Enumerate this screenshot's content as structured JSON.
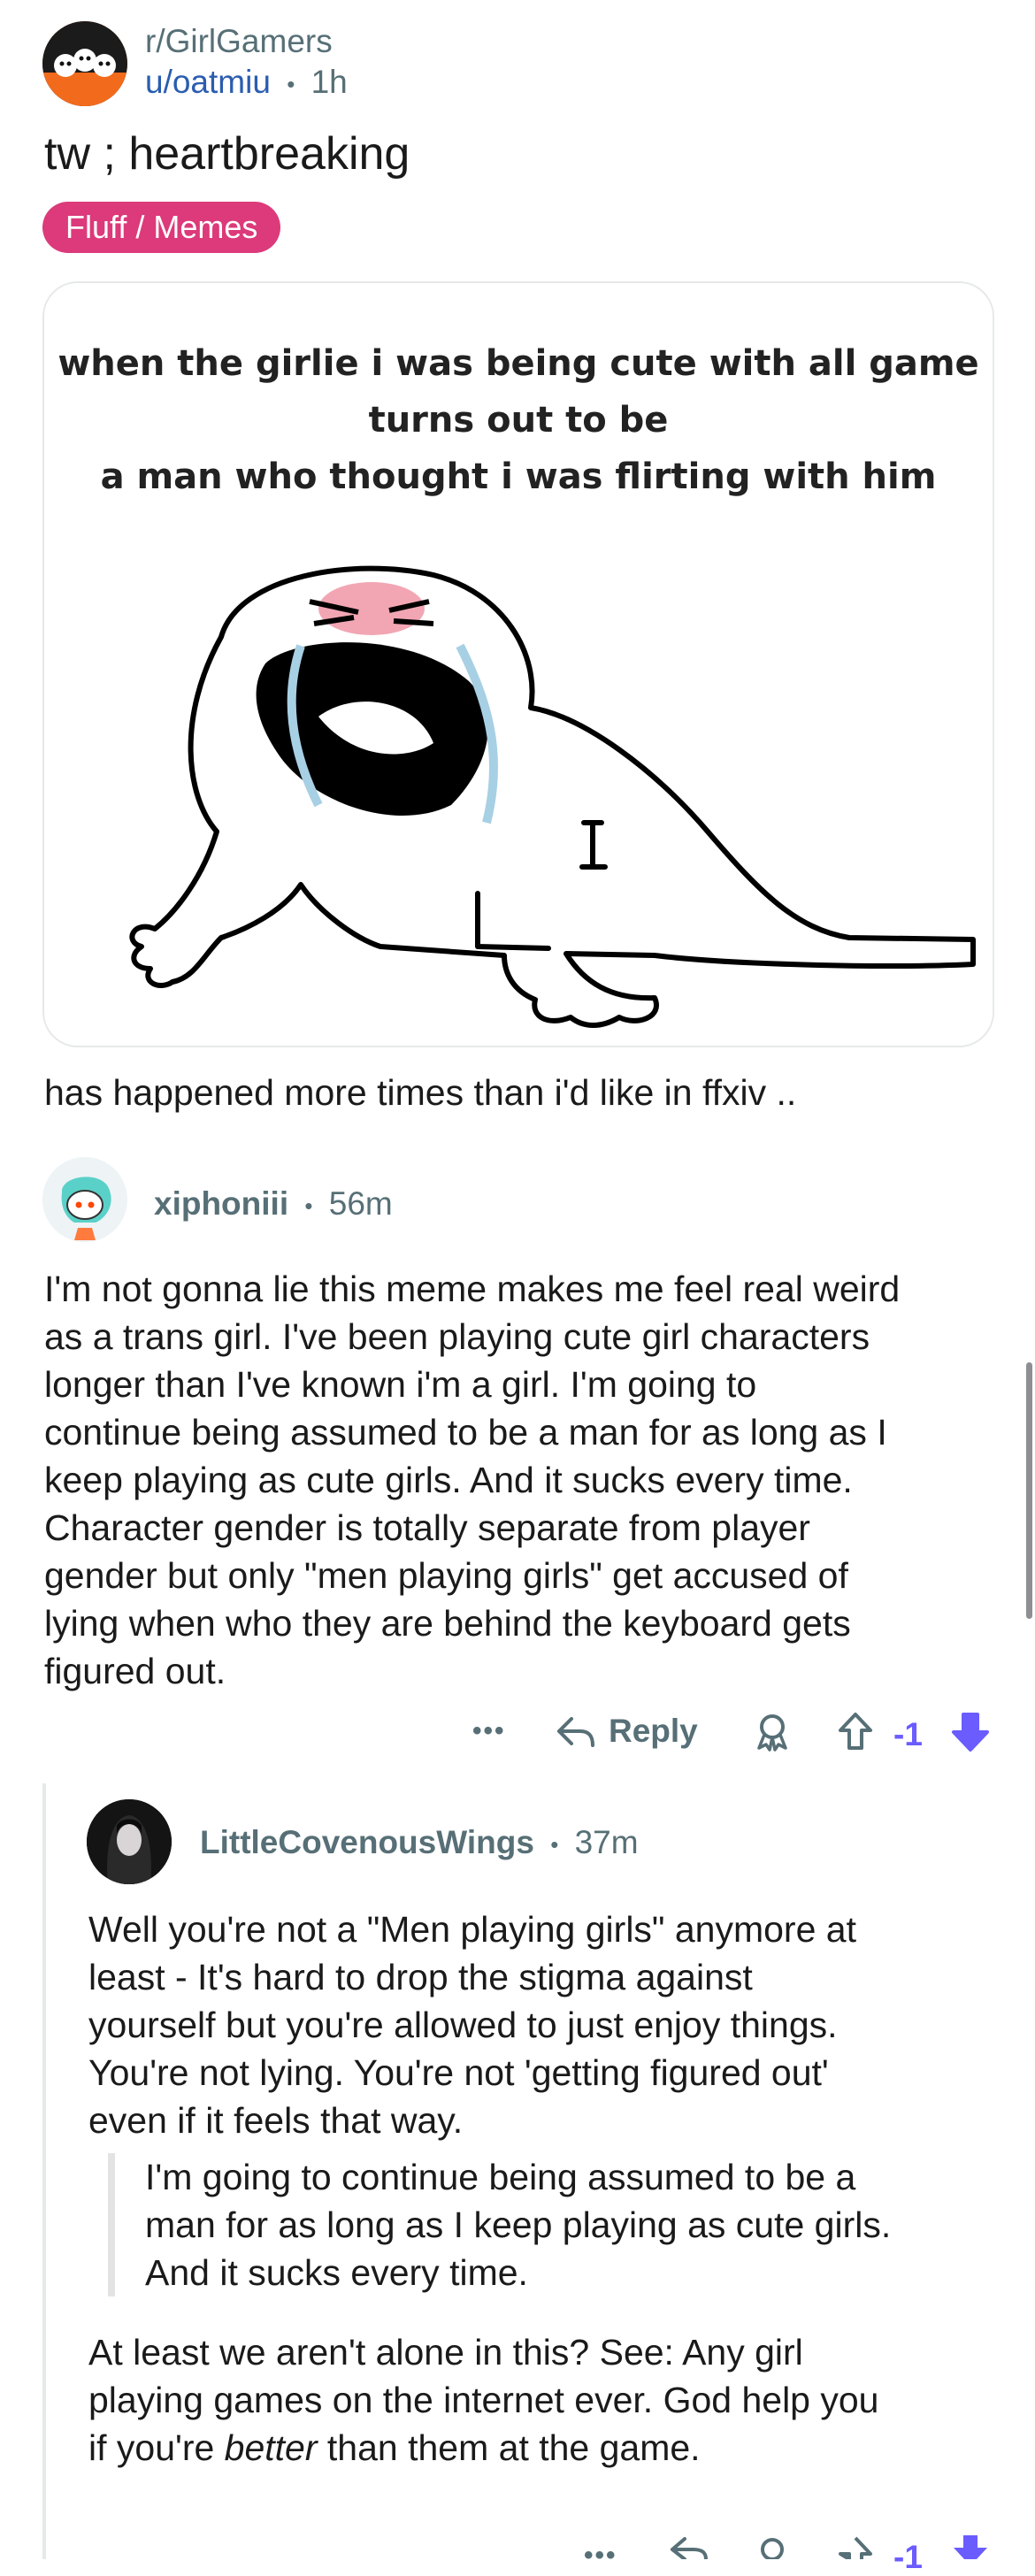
{
  "post": {
    "subreddit": "r/GirlGamers",
    "author": "u/oatmiu",
    "separator": "•",
    "age": "1h",
    "title": "tw ; heartbreaking",
    "flair": "Fluff / Memes",
    "meme_caption_lines": [
      "when the girlie i was being cute with all game",
      "turns out to be",
      "a man who thought i was flirting with him"
    ],
    "body": "has happened more times than i'd like in ffxiv .."
  },
  "comment1": {
    "author": "xiphoniii",
    "separator": "•",
    "age": "56m",
    "body_lines": [
      "I'm not gonna lie this meme makes me feel real weird",
      "as a trans girl. I've been playing cute girl characters",
      "longer than I've known i'm a girl. I'm going to",
      "continue being assumed to be a man for as long as I",
      "keep playing as cute girls. And it sucks every time.",
      "Character gender is totally separate from player",
      "gender but only \"men playing girls\" get accused of",
      "lying when who they are behind the keyboard gets",
      "figured out."
    ],
    "actions": {
      "more": "•••",
      "reply": "Reply",
      "score": "-1"
    }
  },
  "comment2": {
    "author": "LittleCovenousWings",
    "separator": "•",
    "age": "37m",
    "body_lines": [
      "Well you're not a \"Men playing girls\" anymore at",
      "least - It's hard to drop the stigma against",
      "yourself but you're allowed to just enjoy things.",
      "You're not lying. You're not 'getting figured out'",
      "even if it feels that way."
    ],
    "quote_lines": [
      "I'm going to continue being assumed to be a",
      "man for as long as I keep playing as cute girls.",
      "And it sucks every time."
    ],
    "tail_lines": [
      "At least we aren't alone in this? See: Any girl",
      "playing games on the internet ever. God help you"
    ],
    "tail_last_pre": "if you're ",
    "tail_last_em": "better",
    "tail_last_post": " than them at the game.",
    "actions": {
      "more": "•••",
      "score": "-1"
    }
  },
  "colors": {
    "flair_bg": "#dc3a7a",
    "link": "#2a5db0",
    "meta": "#576f76",
    "downvote_active": "#6a5cff",
    "scrollbar": "#8e8e93"
  }
}
